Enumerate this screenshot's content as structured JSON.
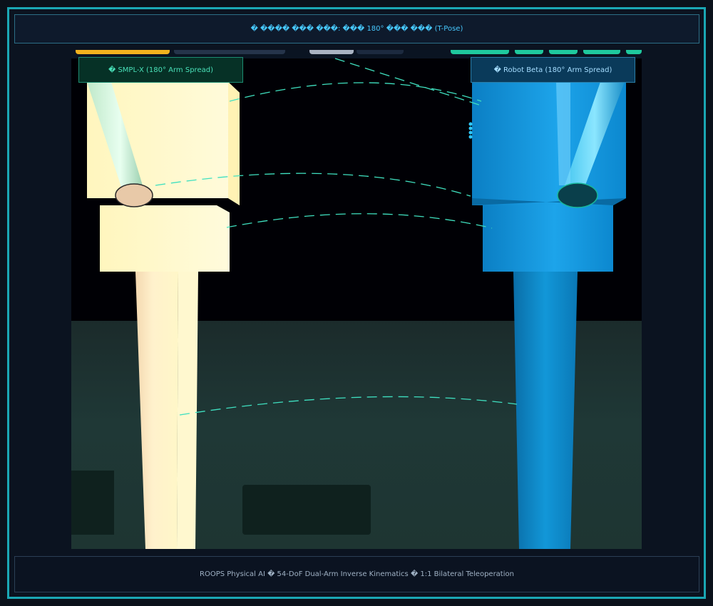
{
  "header": {
    "title": "� ���� ��� ���: ��� 180° ��� ��� (T-Pose)"
  },
  "viewport": {
    "left_label": "� SMPL-X (180° Arm Spread)",
    "right_label": "� Robot Beta (180° Arm Spread)"
  },
  "footer": {
    "text": "ROOPS Physical AI � 54-DoF Dual-Arm Inverse Kinematics � 1:1 Bilateral Teleoperation"
  },
  "colors": {
    "accent": "#1aa7b4",
    "smpl_body": "#fff9c8",
    "robot_body": "#0a86cf",
    "link_line": "#3fe0c0"
  }
}
